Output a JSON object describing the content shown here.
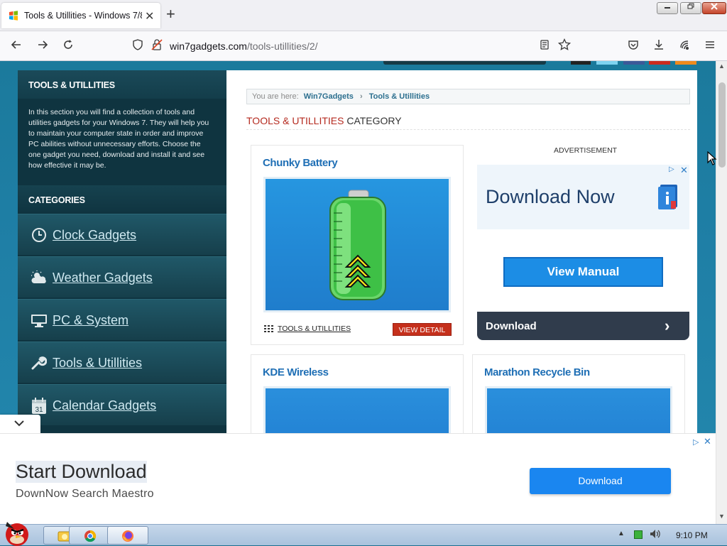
{
  "browser": {
    "tab_title": "Tools & Utillities - Windows 7/8",
    "tab_close": "✕",
    "new_tab": "+",
    "url_domain": "win7gadgets.com",
    "url_path": "/tools-utillities/2/"
  },
  "sidebar": {
    "title": "TOOLS & UTILLITIES",
    "description": "In this section you will find a collection of tools and utilities gadgets for your Windows 7. They will help you to maintain your computer state in order and improve PC abilities without unnecessary efforts. Choose the one gadget you need, download and install it and see how effective it may be.",
    "categories_title": "CATEGORIES",
    "items": [
      {
        "label": "Clock Gadgets",
        "icon": "clock-icon"
      },
      {
        "label": "Weather Gadgets",
        "icon": "weather-icon"
      },
      {
        "label": "PC & System",
        "icon": "monitor-icon"
      },
      {
        "label": "Tools & Utillities",
        "icon": "wrench-icon"
      },
      {
        "label": "Calendar Gadgets",
        "icon": "calendar-icon",
        "day": "31"
      }
    ]
  },
  "content": {
    "breadcrumb": {
      "prefix": "You are here:",
      "items": [
        "Win7Gadgets",
        "Tools & Utillities"
      ]
    },
    "heading_red": "TOOLS & UTILLITIES",
    "heading_rest": " CATEGORY",
    "cards": [
      {
        "title": "Chunky Battery",
        "category": "TOOLS & UTILLITIES",
        "button": "VIEW DETAIL"
      },
      {
        "title": "KDE Wireless"
      },
      {
        "title": "Marathon Recycle Bin"
      }
    ],
    "advertisement_label": "ADVERTISEMENT",
    "ad": {
      "headline": "Download Now",
      "button": "View Manual",
      "bar_label": "Download",
      "bar_arrow": "›"
    }
  },
  "overlay_ad": {
    "title": "Start Download",
    "subtitle": "DownNow Search Maestro",
    "button": "Download"
  },
  "taskbar": {
    "clock": "9:10 PM"
  },
  "colors": {
    "accent_red": "#b52a1f",
    "link_blue": "#1f6fb5",
    "sidebar_bg": "#0f3440",
    "ad_button_blue": "#1c8de5"
  }
}
